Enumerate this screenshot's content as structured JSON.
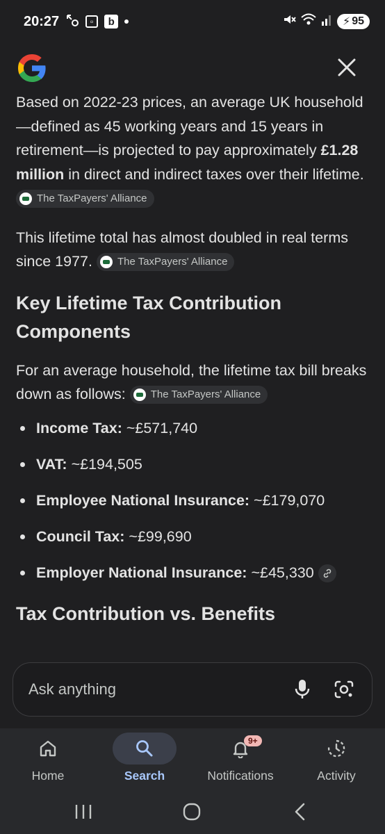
{
  "status_bar": {
    "time": "20:27",
    "notif_icons": [
      "missed-call-icon",
      "screenshot-icon",
      "b-app-icon",
      "dot-icon"
    ],
    "right_icons": [
      "mute-icon",
      "wifi-icon",
      "signal-icon"
    ],
    "battery": "95"
  },
  "header": {
    "logo": "google-g-logo",
    "close_icon": "close-icon"
  },
  "content": {
    "para1": {
      "before": "Based on 2022-23 prices, an average UK household—defined as 45 working years and 15 years in retirement—is projected to pay approximately ",
      "bold": "£1.28 million",
      "after": " in direct and indirect taxes over their lifetime.",
      "source": "The TaxPayers' Alliance"
    },
    "para2": {
      "text": "This lifetime total has almost doubled in real terms since 1977.",
      "source": "The TaxPayers' Alliance"
    },
    "heading1": "Key Lifetime Tax Contribution Components",
    "para3": {
      "text": "For an average household, the lifetime tax bill breaks down as follows:",
      "source": "The TaxPayers' Alliance"
    },
    "list": [
      {
        "label": "Income Tax:",
        "value": " ~£571,740"
      },
      {
        "label": "VAT:",
        "value": " ~£194,505"
      },
      {
        "label": "Employee National Insurance:",
        "value": " ~£179,070"
      },
      {
        "label": "Council Tax:",
        "value": " ~£99,690"
      },
      {
        "label": "Employer National Insurance:",
        "value": " ~£45,330"
      }
    ],
    "heading2": "Tax Contribution vs. Benefits"
  },
  "ask": {
    "placeholder": "Ask anything"
  },
  "nav": {
    "items": [
      {
        "label": "Home",
        "icon": "home-icon"
      },
      {
        "label": "Search",
        "icon": "search-icon"
      },
      {
        "label": "Notifications",
        "icon": "bell-icon",
        "badge": "9+"
      },
      {
        "label": "Activity",
        "icon": "activity-icon"
      }
    ],
    "active": "Search"
  },
  "colors": {
    "background": "#1f1f21",
    "accent": "#a8c7fa",
    "badge": "#f2b8b5"
  }
}
